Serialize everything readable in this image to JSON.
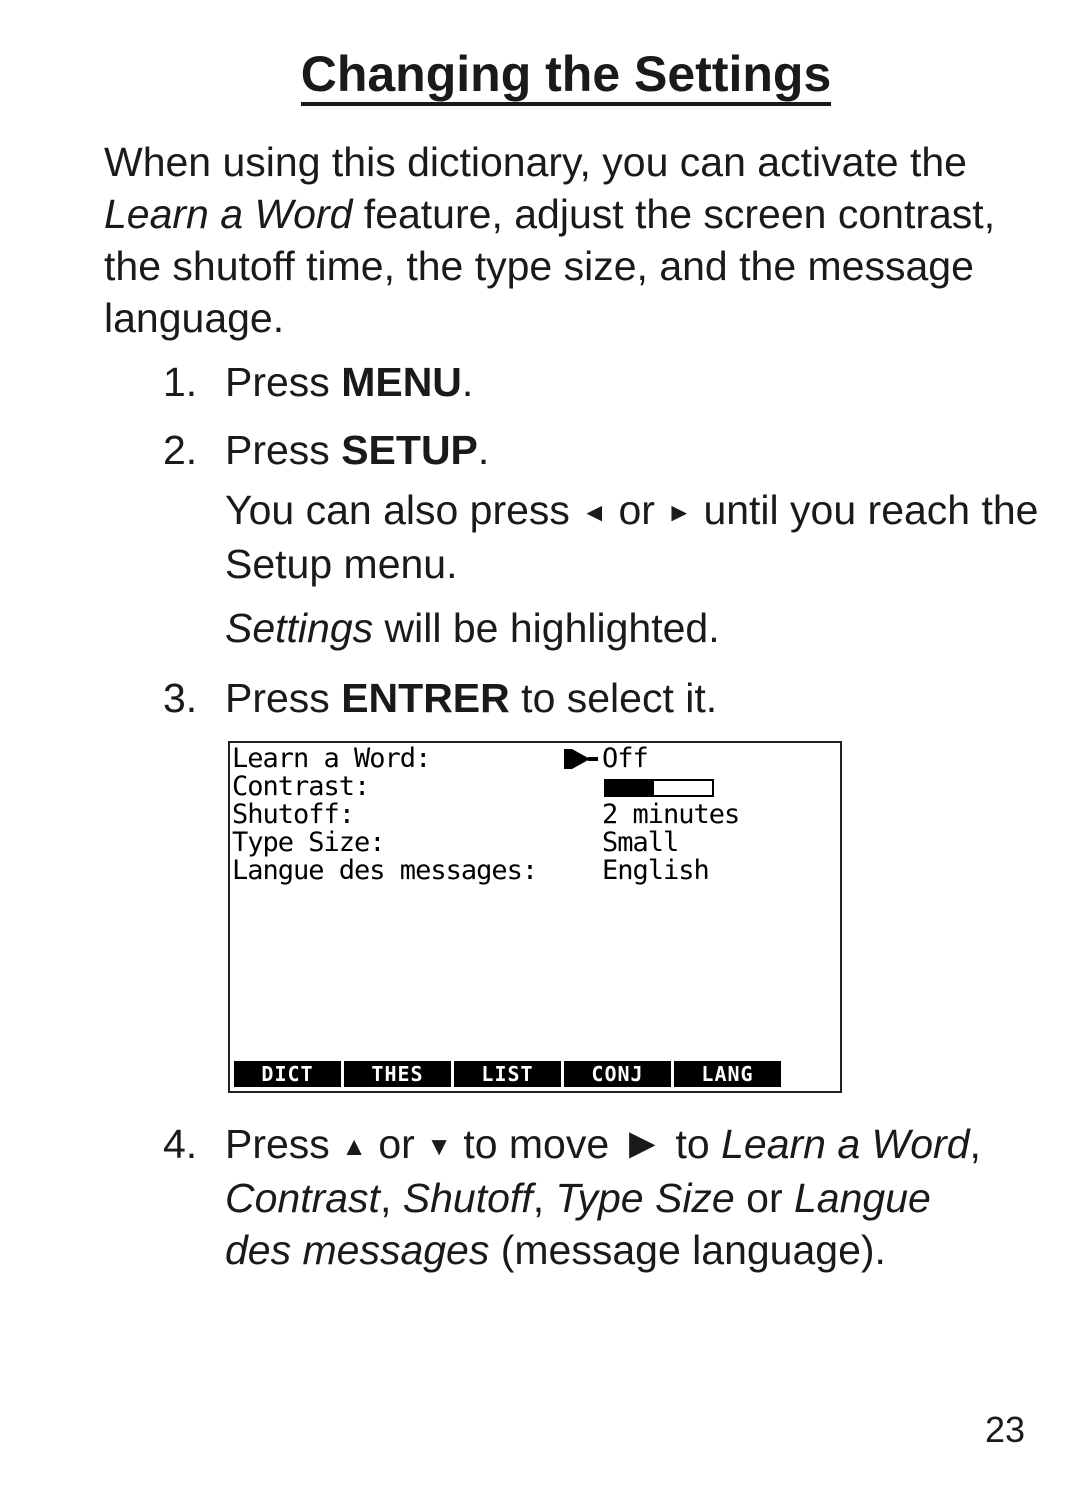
{
  "title": "Changing the Settings",
  "intro": {
    "part1": "When using this dictionary, you can activate the ",
    "feature": "Learn a Word",
    "part2": " feature, adjust the screen contrast, the shutoff time, the type size, and the message language."
  },
  "steps": [
    {
      "num": "1.",
      "pre": "Press ",
      "key": "MENU",
      "post": "."
    },
    {
      "num": "2.",
      "pre": "Press ",
      "key": "SETUP",
      "post": "."
    },
    {
      "num": "3.",
      "pre": "Press ",
      "key": "ENTRER",
      "post": " to select it."
    }
  ],
  "step2_note": {
    "pre": "You can also press ",
    "left_arrow": "◄",
    "mid": " or ",
    "right_arrow": "►",
    "post": " until you reach the Setup menu."
  },
  "step2_highlight": {
    "italic": "Settings",
    "rest": " will be highlighted."
  },
  "step4": {
    "num": "4.",
    "pre": "Press ",
    "up_arrow": "▲",
    "or": " or ",
    "down_arrow": "▼",
    "to_move": " to move ",
    "pointer": "►",
    "to": " to ",
    "opt1": "Learn a Word",
    "sep1": ", ",
    "opt2": "Contrast",
    "sep2": ", ",
    "opt3": "Shutoff",
    "sep3": ", ",
    "opt4": "Type Size",
    "or2": " or ",
    "opt5": "Langue des messages",
    "post": " (message language)."
  },
  "screen": {
    "rows": [
      {
        "label": "Learn a Word:",
        "value": "Off"
      },
      {
        "label": "Contrast:",
        "value": ""
      },
      {
        "label": "Shutoff:",
        "value": "2 minutes"
      },
      {
        "label": "Type Size:",
        "value": "Small"
      },
      {
        "label": "Langue des messages:",
        "value": "English"
      }
    ],
    "contrast_level_percent": 45,
    "selected_row": "Learn a Word",
    "softkeys": [
      "DICT",
      "THES",
      "LIST",
      "CONJ",
      "LANG"
    ]
  },
  "page_number": "23"
}
